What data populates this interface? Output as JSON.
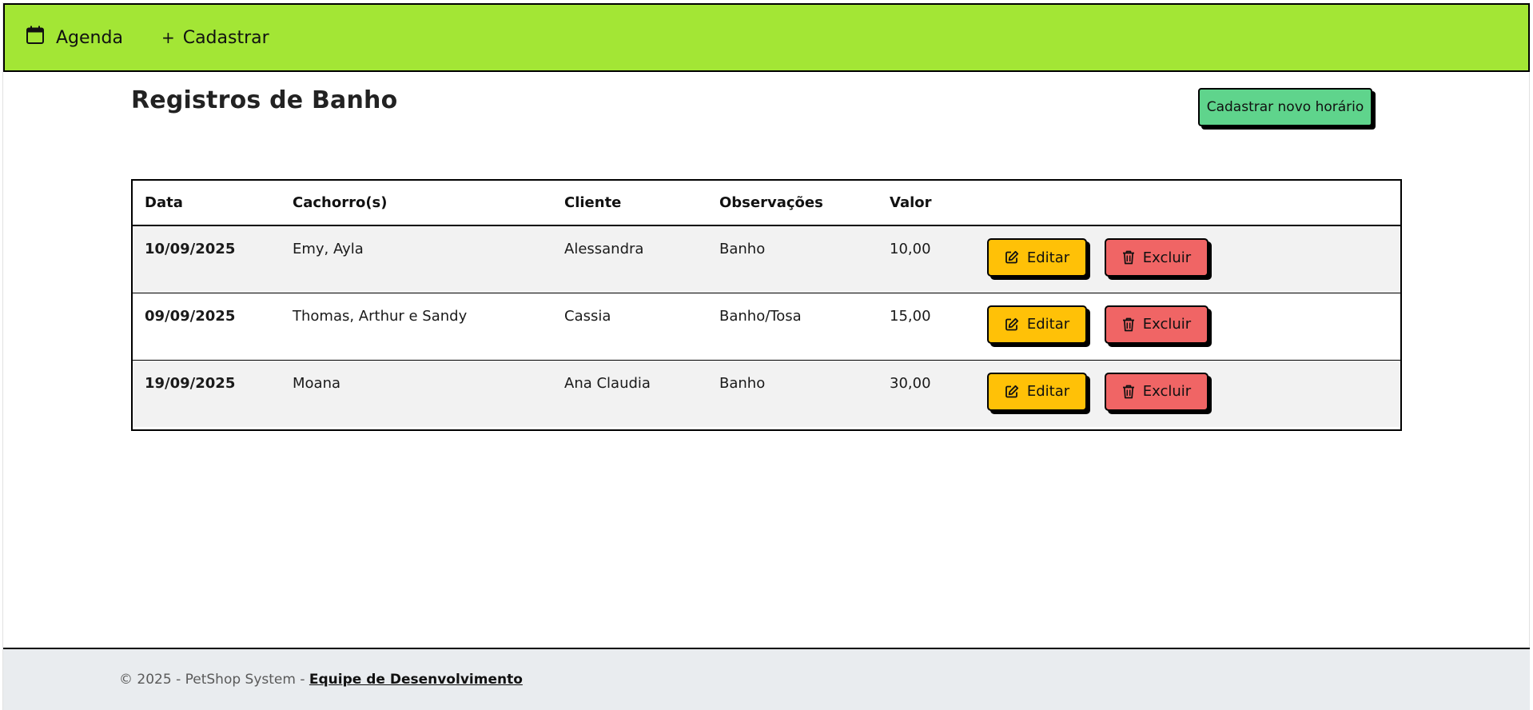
{
  "navbar": {
    "agenda_label": "Agenda",
    "cadastrar_plus": "+",
    "cadastrar_label": "Cadastrar",
    "bg_color": "#a3e635"
  },
  "main": {
    "title": "Registros de Banho",
    "new_button_label": "Cadastrar novo horário",
    "new_button_color": "#5fd48c"
  },
  "table": {
    "headers": [
      "Data",
      "Cachorro(s)",
      "Cliente",
      "Observações",
      "Valor",
      ""
    ],
    "rows": [
      {
        "data": "10/09/2025",
        "cachorros": "Emy, Ayla",
        "cliente": "Alessandra",
        "observacoes": "Banho",
        "valor": "10,00"
      },
      {
        "data": "09/09/2025",
        "cachorros": "Thomas, Arthur e Sandy",
        "cliente": "Cassia",
        "observacoes": "Banho/Tosa",
        "valor": "15,00"
      },
      {
        "data": "19/09/2025",
        "cachorros": "Moana",
        "cliente": "Ana Claudia",
        "observacoes": "Banho",
        "valor": "30,00"
      }
    ],
    "edit_label": "Editar",
    "delete_label": "Excluir",
    "edit_color": "#ffc107",
    "delete_color": "#f06565"
  },
  "icons": {
    "agenda": "calendar-icon",
    "cadastrar": "plus-icon",
    "edit": "pencil-square-icon",
    "delete": "trash-icon"
  },
  "footer": {
    "text": "© 2025 - PetShop System - ",
    "link": "Equipe de Desenvolvimento"
  }
}
